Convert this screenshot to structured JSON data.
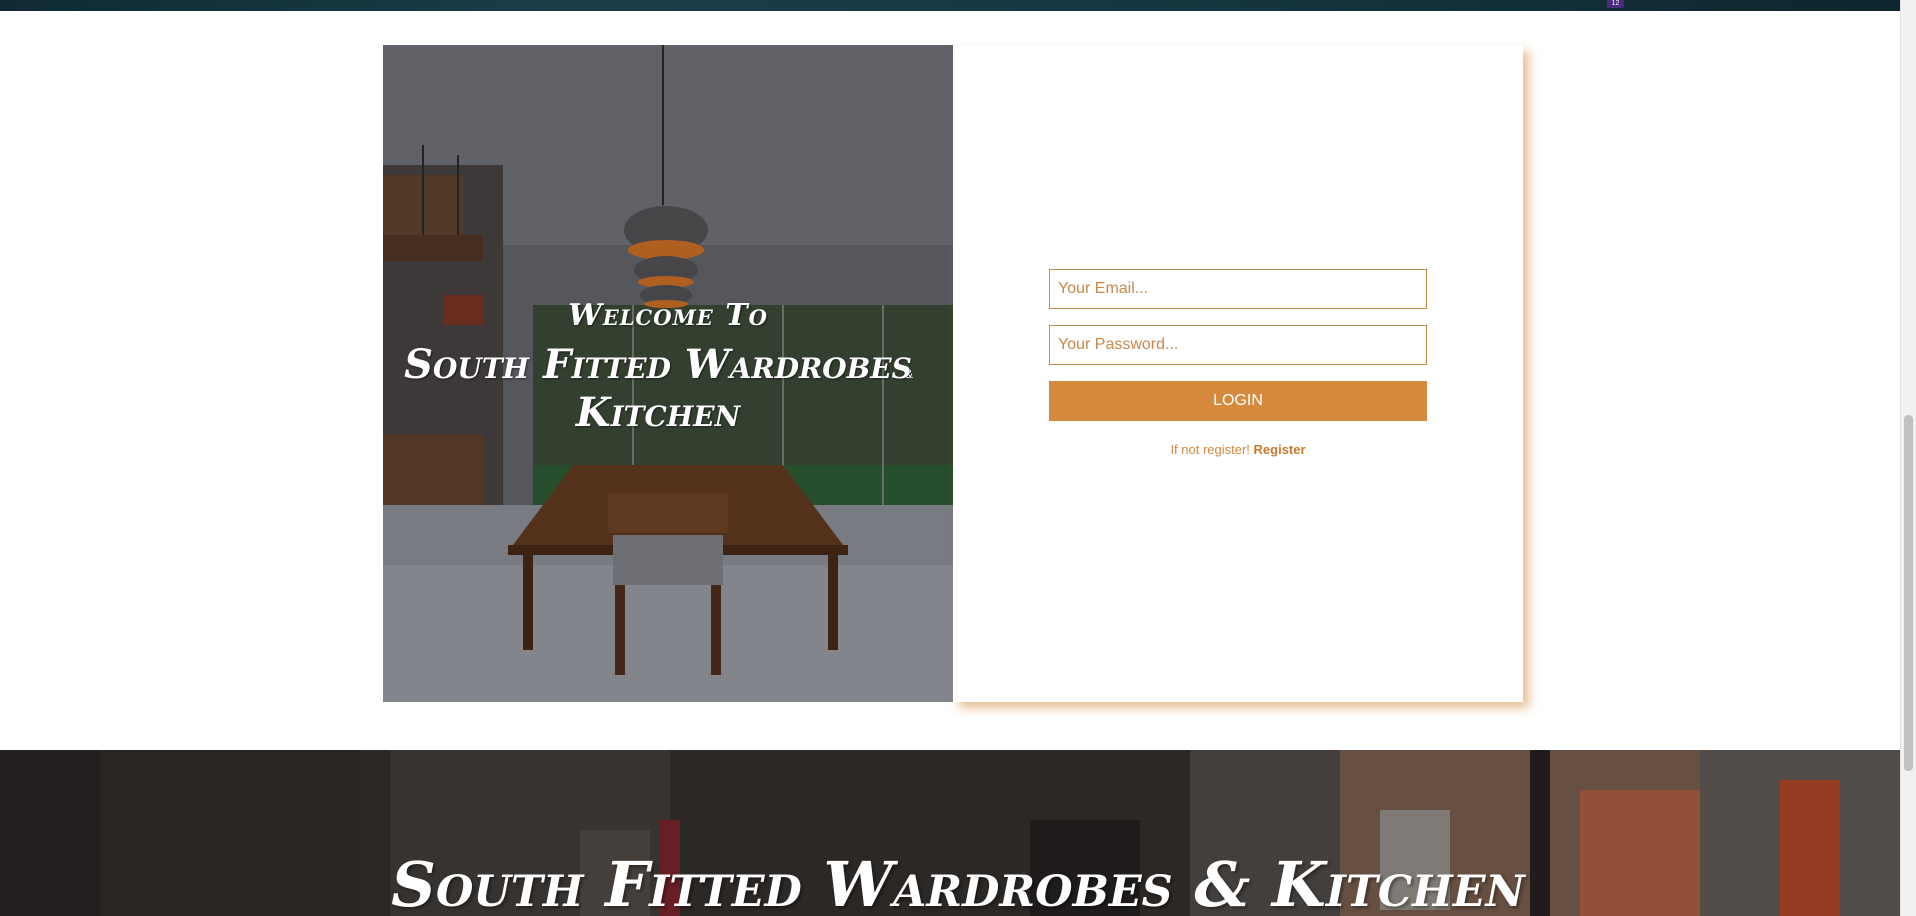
{
  "top_strip": {
    "badge": "12"
  },
  "hero": {
    "welcome": "Welcome To",
    "title": "South Fitted Wardrobes Kitchen",
    "ampersand": "&"
  },
  "form": {
    "email_placeholder": "Your Email...",
    "password_placeholder": "Your Password...",
    "login_label": "LOGIN",
    "register_prompt": "If not register! ",
    "register_link": "Register"
  },
  "banner": {
    "title": "South Fitted Wardrobes & Kitchen"
  },
  "colors": {
    "accent": "#d58a3e",
    "input_border": "#c98a4e",
    "placeholder": "#c9874a"
  }
}
